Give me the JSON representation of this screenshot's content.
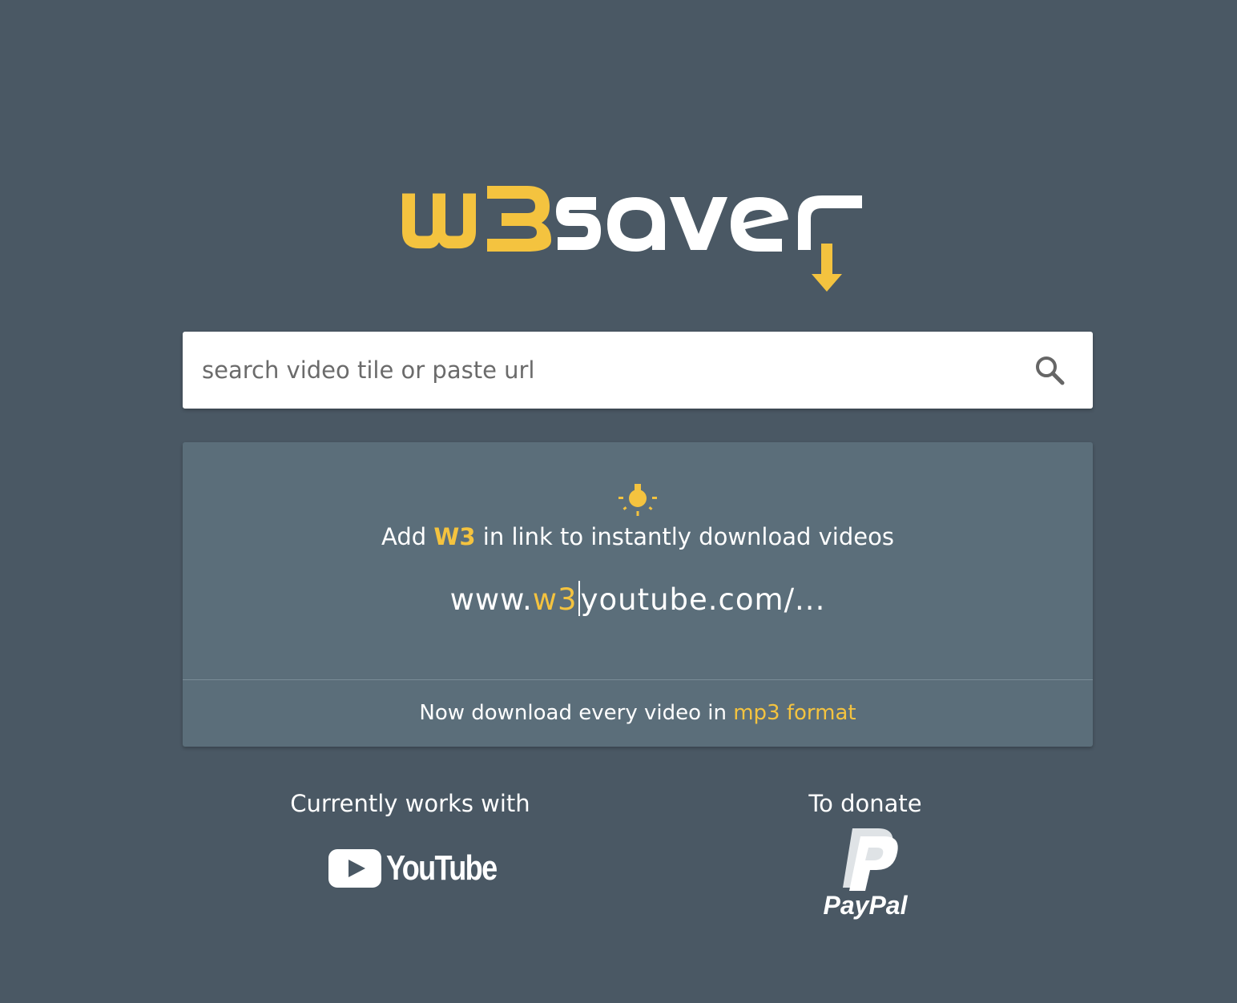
{
  "logo": {
    "text_w3": "w3",
    "text_saver": "saver",
    "accent_color": "#f4c33f",
    "icon": "download-arrow-icon"
  },
  "search": {
    "placeholder": "search video tile or paste url",
    "value": "",
    "icon": "search-icon"
  },
  "tip": {
    "icon": "lightbulb-icon",
    "prefix": "Add ",
    "highlight": "W3",
    "suffix": " in link to instantly download videos",
    "example_prefix": "www.",
    "example_highlight": "w3",
    "example_suffix": "youtube.com/..."
  },
  "mp3": {
    "text": "Now download every video in ",
    "link_label": "mp3 format"
  },
  "works_with": {
    "label": "Currently works with",
    "brand": "YouTube",
    "icon": "youtube-play-icon"
  },
  "donate": {
    "label": "To donate",
    "brand": "PayPal",
    "icon": "paypal-icon"
  },
  "colors": {
    "background": "#4a5864",
    "card": "#5b6e7a",
    "accent": "#f4c33f"
  }
}
